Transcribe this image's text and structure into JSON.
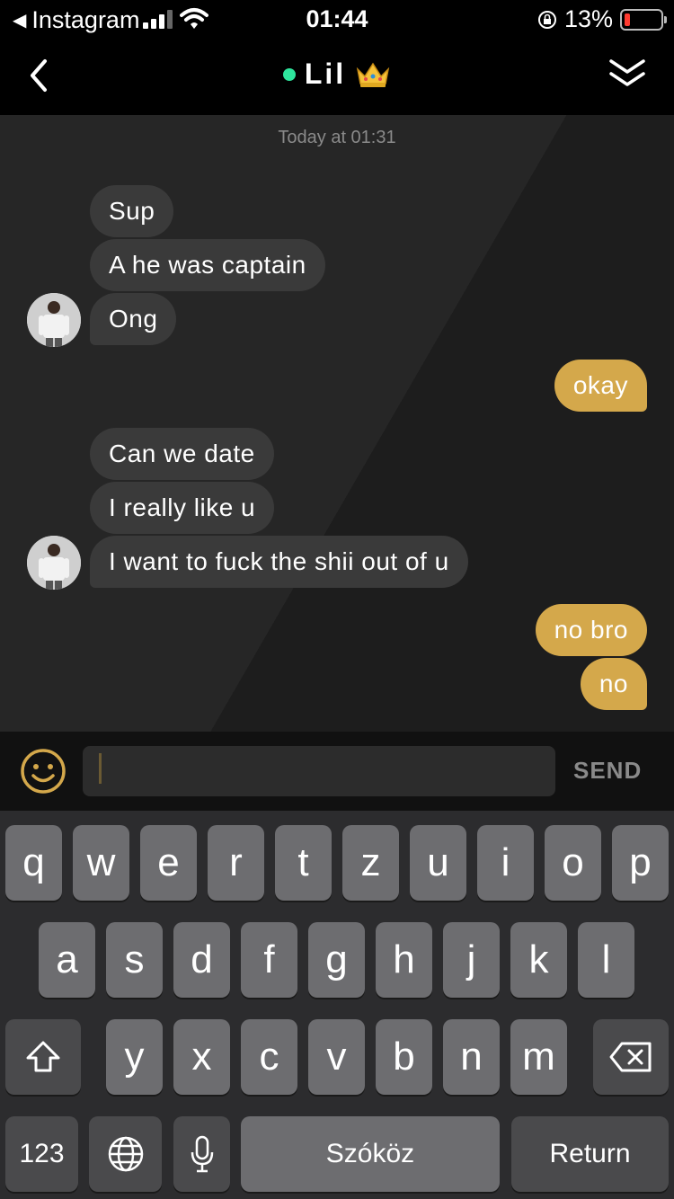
{
  "status_bar": {
    "back_app": "Instagram",
    "time": "01:44",
    "battery": "13%",
    "icons": [
      "back-triangle-icon",
      "signal-icon",
      "wifi-icon",
      "orientation-lock-icon",
      "battery-icon"
    ]
  },
  "header": {
    "title": "Lil",
    "online": true,
    "status_color": "#2ee59d",
    "icons": [
      "back-chevron-icon",
      "crown-emoji",
      "double-chevron-down-icon"
    ]
  },
  "chat": {
    "timestamp": "Today at 01:31",
    "messages": [
      {
        "side": "in",
        "text": "Sup"
      },
      {
        "side": "in",
        "text": "A he was captain"
      },
      {
        "side": "in",
        "text": "Ong"
      },
      {
        "side": "out",
        "text": "okay"
      },
      {
        "side": "in",
        "text": "Can we date"
      },
      {
        "side": "in",
        "text": "I really like u"
      },
      {
        "side": "in",
        "text": "I want to fuck the shii out of u"
      },
      {
        "side": "out",
        "text": "no bro"
      },
      {
        "side": "out",
        "text": "no"
      }
    ]
  },
  "composer": {
    "value": "",
    "send_label": "SEND",
    "accent_color": "#d4a84b"
  },
  "keyboard": {
    "row1": [
      "q",
      "w",
      "e",
      "r",
      "t",
      "z",
      "u",
      "i",
      "o",
      "p"
    ],
    "row2": [
      "a",
      "s",
      "d",
      "f",
      "g",
      "h",
      "j",
      "k",
      "l"
    ],
    "row3": [
      "y",
      "x",
      "c",
      "v",
      "b",
      "n",
      "m"
    ],
    "numbers_key": "123",
    "space_key": "Szóköz",
    "return_key": "Return"
  }
}
